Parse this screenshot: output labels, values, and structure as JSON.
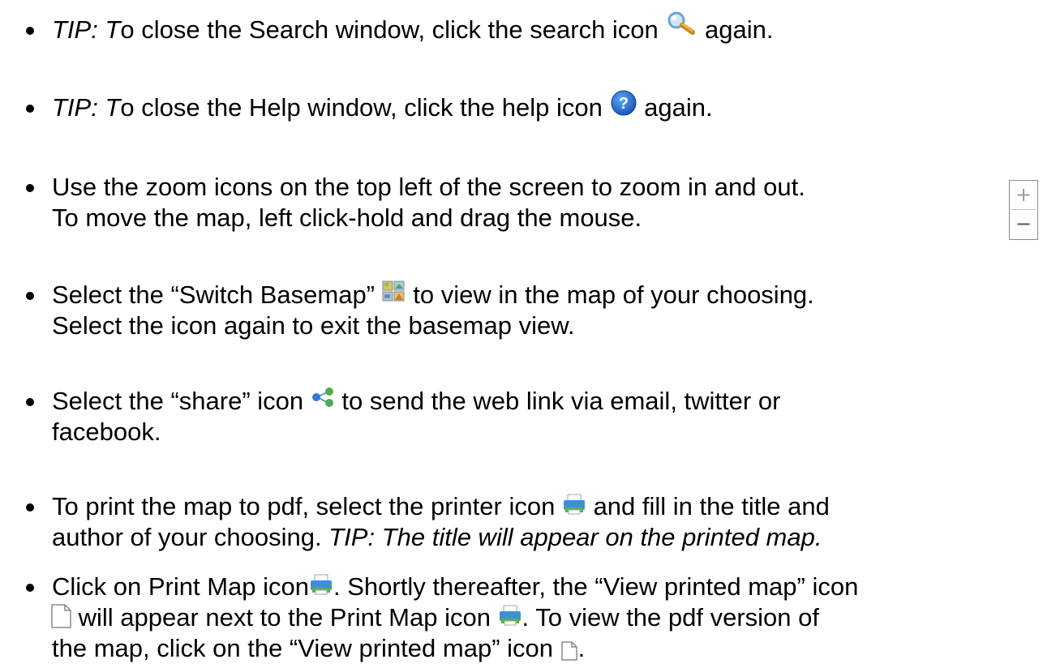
{
  "items": [
    {
      "segments": [
        {
          "t": "TIP: T",
          "italic": true
        },
        {
          "t": "o close the Search window, click the search icon "
        },
        {
          "icon": "search-icon"
        },
        {
          "t": " again."
        }
      ]
    },
    {
      "segments": [
        {
          "t": "TIP: T",
          "italic": true
        },
        {
          "t": "o close the Help window, click the help icon "
        },
        {
          "icon": "help-icon"
        },
        {
          "t": " again."
        }
      ]
    },
    {
      "lines": [
        "Use the zoom icons on the top left of the screen to zoom in and out.",
        "To move the map, left click-hold and drag the mouse."
      ]
    },
    {
      "line1": [
        "Select the “Switch Basemap” ",
        " to view in the map of your choosing."
      ],
      "line2": "Select the icon again to exit the basemap view."
    },
    {
      "line1": [
        "Select the “share” icon ",
        " to send the web link via email, twitter or"
      ],
      "line2": "facebook."
    },
    {
      "line1": [
        "To print the map to pdf, select the printer icon ",
        " and fill in the title and"
      ],
      "line2_plain": "author of your choosing. ",
      "line2_italic": "TIP: The title will appear on the printed map."
    },
    {
      "line1": [
        "Click on Print Map icon",
        ". Shortly thereafter, the “View printed map” icon"
      ],
      "line2": [
        " will appear next to the Print Map icon ",
        ". To view the pdf version of"
      ],
      "line3": [
        "the map, click on the “View printed map” icon ",
        "."
      ]
    }
  ],
  "zoom": {
    "in_label": "+",
    "out_label": "−"
  },
  "colors": {
    "text": "#000000",
    "help_blue": "#1e6fd9",
    "printer_blue": "#3f8fd8",
    "printer_green": "#5fb33a"
  }
}
